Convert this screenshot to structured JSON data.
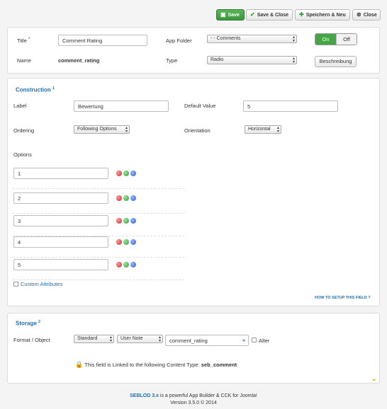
{
  "toolbar": {
    "save": "Save",
    "save_close": "Save & Close",
    "save_new": "Speichern & Neu",
    "close": "Close"
  },
  "header": {
    "title_label": "Title",
    "title_required": "*",
    "title_value": "Comment Rating",
    "name_label": "Name",
    "name_value": "comment_rating",
    "app_folder_label": "App Folder",
    "app_folder_value": "- - Comments",
    "type_label": "Type",
    "type_value": "Radio",
    "toggle_on": "On",
    "toggle_off": "Off",
    "toggle_state": "On",
    "description_button": "Beschreibung"
  },
  "construction": {
    "title": "Construction",
    "title_sup": "1",
    "label_label": "Label",
    "label_value": "Bewertung",
    "default_value_label": "Default Value",
    "default_value": "5",
    "ordering_label": "Ordering",
    "ordering_value": "Following Options",
    "orientation_label": "Orientation",
    "orientation_value": "Horizontal",
    "options_label": "Options",
    "options": [
      "1",
      "2",
      "3",
      "4",
      "5"
    ],
    "custom_attributes": "Custom Attributes",
    "setup_link": "HOW TO SETUP THIS FIELD ?"
  },
  "storage": {
    "title": "Storage",
    "title_sup": "2",
    "format_label": "Format / Object",
    "format_value": "Standard",
    "object_value": "User Note",
    "field_value": "comment_rating",
    "field_arrow": "«",
    "alter_label": "Alter",
    "linked_text": "This field is Linked to the following Content Type:",
    "linked_type": "seb_comment"
  },
  "footer": {
    "brand": "SEBLOD 3.x",
    "tagline": " is a powerful App Builder & CCK for Joomla!",
    "version": "Version 3.5.0 © 2014"
  },
  "colors": {
    "accent_green": "#46a546",
    "link_blue": "#1f6fb2",
    "footer_brand": "#1f6fb2"
  }
}
